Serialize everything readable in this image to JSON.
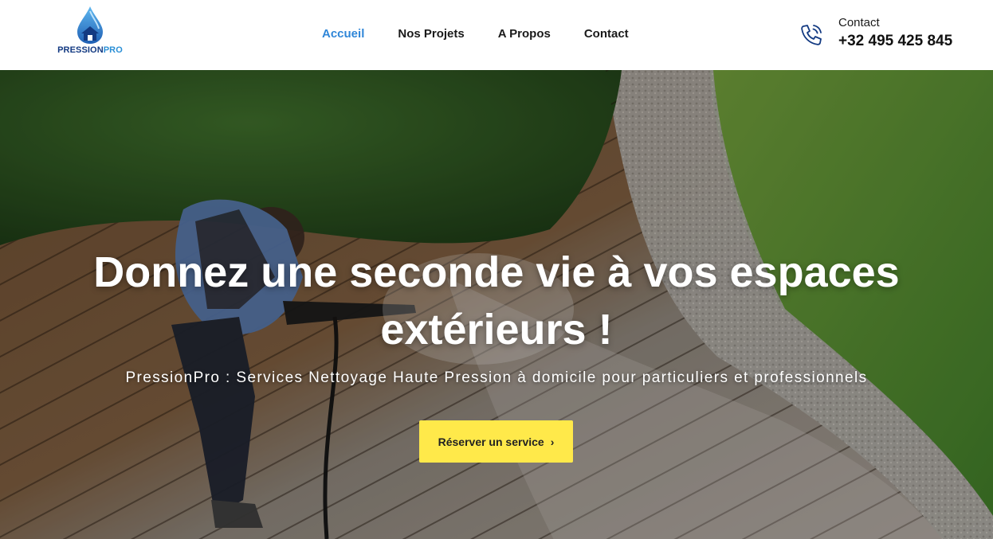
{
  "header": {
    "logo": {
      "part1": "PRESSION",
      "part2": "PRO"
    },
    "nav": [
      {
        "label": "Accueil",
        "active": true
      },
      {
        "label": "Nos Projets",
        "active": false
      },
      {
        "label": "A Propos",
        "active": false
      },
      {
        "label": "Contact",
        "active": false
      }
    ],
    "contact": {
      "label": "Contact",
      "phone": "+32 495 425 845",
      "icon": "phone-icon"
    }
  },
  "hero": {
    "title_line1": "Donnez une seconde vie à vos espaces",
    "title_line2": "extérieurs !",
    "subtitle": "PressionPro : Services Nettoyage Haute Pression à domicile pour particuliers et professionnels",
    "cta_label": "Réserver un service",
    "cta_icon": "chevron-right-icon"
  },
  "colors": {
    "accent_blue": "#2f86d8",
    "logo_navy": "#133a82",
    "cta_yellow": "#ffe94a"
  }
}
